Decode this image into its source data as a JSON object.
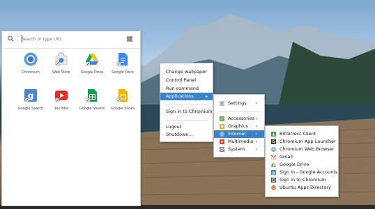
{
  "launcher": {
    "search_placeholder": "Search or type URL",
    "apps": [
      {
        "label": "Chromium",
        "icon": "chromium-icon"
      },
      {
        "label": "Web Store",
        "icon": "web-store-icon"
      },
      {
        "label": "Google Drive",
        "icon": "google-drive-icon"
      },
      {
        "label": "Google Docs",
        "icon": "google-docs-icon"
      },
      {
        "label": "Google Search",
        "icon": "google-search-icon"
      },
      {
        "label": "YouTube",
        "icon": "youtube-icon"
      },
      {
        "label": "Google Sheets",
        "icon": "google-sheets-icon"
      },
      {
        "label": "Google Slides",
        "icon": "google-slides-icon"
      }
    ]
  },
  "context_menu": {
    "items": [
      "Change wallpaper",
      "Control Panel",
      "Run command",
      "Applications",
      "Sign in to Chromium",
      "Logout",
      "Shutdown..."
    ]
  },
  "applications_menu": {
    "items": [
      "Settings",
      "Accessories",
      "Graphics",
      "Internet",
      "Multimedia",
      "System"
    ]
  },
  "internet_menu": {
    "items": [
      "BitTorrent Client",
      "Chromium App Launcher",
      "Chromium Web Browser",
      "Gmail",
      "Google Drive",
      "Sign in - Google Accounts",
      "Sign in to Chromium",
      "Ubuntu Apps Directory"
    ]
  },
  "colors": {
    "selection": "#3d82c4"
  }
}
